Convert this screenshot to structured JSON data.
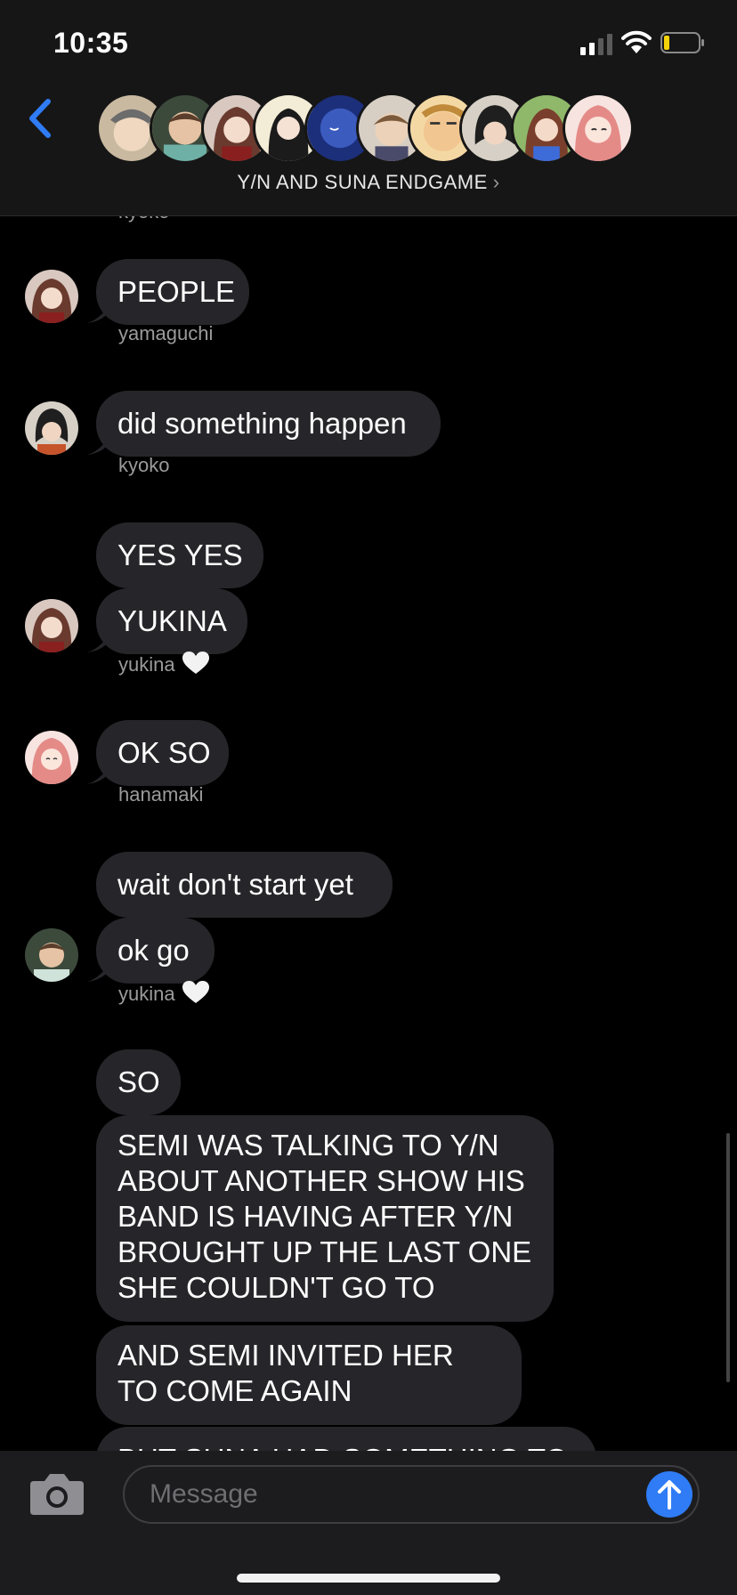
{
  "status_bar": {
    "time": "10:35"
  },
  "header": {
    "group_name": "Y/N AND SUNA ENDGAME",
    "chevron": "›",
    "participant_count_shown": 10
  },
  "messages": [
    {
      "sender": "kyoko",
      "texts": [
        "PEOPLE"
      ]
    },
    {
      "sender": "yamaguchi",
      "texts": [
        "did something happen"
      ]
    },
    {
      "sender": "kyoko",
      "texts": [
        "YES YES",
        "YUKINA"
      ]
    },
    {
      "sender": "yukina",
      "texts": [
        "OK SO"
      ]
    },
    {
      "sender": "hanamaki",
      "texts": [
        "wait don't start yet",
        "ok go"
      ]
    },
    {
      "sender": "yukina",
      "texts": [
        "SO",
        "SEMI WAS TALKING TO Y/N ABOUT ANOTHER SHOW HIS BAND IS HAVING AFTER Y/N BROUGHT UP THE LAST ONE SHE COULDN'T GO TO",
        "AND SEMI INVITED HER TO COME AGAIN",
        "BUT SUNA HAD SOMETHING TO"
      ]
    }
  ],
  "input": {
    "placeholder": "Message"
  },
  "colors": {
    "header_bg": "#161616",
    "bubble_bg": "#26262a",
    "send_blue": "#2f7cf6",
    "back_blue": "#2f7cf6",
    "sender_gray": "#9b9b9b"
  },
  "icons": {
    "back": "chevron-left-icon",
    "camera": "camera-icon",
    "send": "arrow-up-icon",
    "heart": "white-heart-icon"
  }
}
